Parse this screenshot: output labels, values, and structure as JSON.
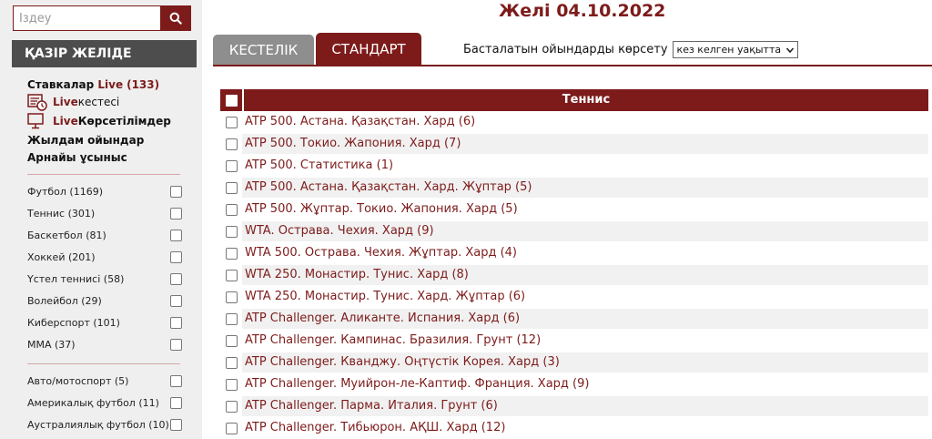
{
  "search": {
    "placeholder": "Іздеу"
  },
  "colors": {
    "accent": "#7d1b1b",
    "sidebar_bg": "#efefef",
    "header_bg": "#4d4d4d"
  },
  "sidebar": {
    "header": "ҚАЗІР ЖЕЛІДЕ",
    "live": {
      "title_prefix": "Ставкалар ",
      "title_highlight": "Live",
      "count": "(133)",
      "schedule_hl": "Live",
      "schedule_label": " кестесі",
      "broadcasts_hl": "Live",
      "broadcasts_label": " Көрсетілімдер",
      "fast_games": "Жылдам ойындар",
      "special_offer": "Арнайы ұсыныс"
    },
    "sports": [
      "Футбол (1169)",
      "Теннис (301)",
      "Баскетбол (81)",
      "Хоккей (201)",
      "Үстел теннисі (58)",
      "Волейбол (29)",
      "Киберспорт (101)",
      "MMA (37)"
    ],
    "sports2": [
      "Авто/мотоспорт (5)",
      "Америкалық футбол (11)",
      "Аустралиялық футбол (10)"
    ]
  },
  "main": {
    "title": "Желі 04.10.2022",
    "tabs": [
      {
        "label": "КЕСТЕЛІК",
        "active": false
      },
      {
        "label": "СТАНДАРТ",
        "active": true
      }
    ],
    "filter": {
      "label": "Басталатын ойындарды көрсету",
      "selected": "кез келген уақытта"
    },
    "table": {
      "title": "Теннис",
      "rows": [
        "ATP 500. Астана. Қазақстан. Хард (6)",
        "ATP 500. Токио. Жапония. Хард (7)",
        "ATP 500. Статистика (1)",
        "ATP 500. Астана. Қазақстан. Хард. Жұптар (5)",
        "ATP 500. Жұптар. Токио. Жапония. Хард (5)",
        "WTA. Острава. Чехия. Хард (9)",
        "WTA 500. Острава. Чехия. Жұптар. Хард (4)",
        "WTA 250. Монастир. Тунис. Хард (8)",
        "WTA 250. Монастир. Тунис. Хард. Жұптар (6)",
        "ATP Challenger. Аликанте. Испания. Хард (6)",
        "ATP Challenger. Кампинас. Бразилия. Грунт (12)",
        "ATP Challenger. Кванджу. Оңтүстік Корея. Хард (3)",
        "ATP Challenger. Муийрон-ле-Каптиф. Франция. Хард (9)",
        "ATP Challenger. Парма. Италия. Грунт (6)",
        "ATP Challenger. Тибьюрон. АҚШ. Хард (12)"
      ]
    }
  }
}
